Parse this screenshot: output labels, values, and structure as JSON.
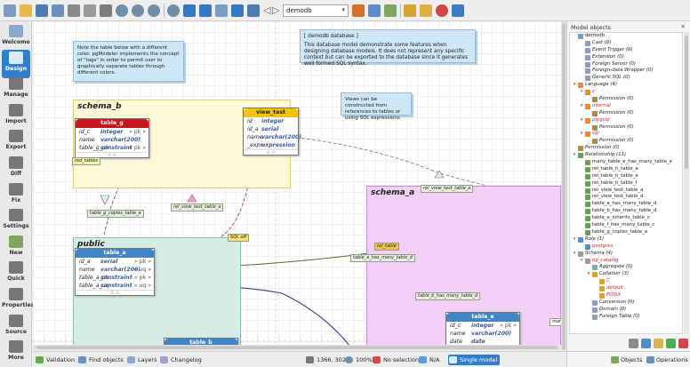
{
  "toolbar": {
    "database_combo": "demodb",
    "icons": [
      "new-model-icon",
      "open-icon",
      "save-icon",
      "save-as-icon",
      "print-icon",
      "print-preview-icon",
      "undo-icon",
      "zoom-in-icon",
      "zoom-out-icon",
      "zoom-normal-icon",
      "zoom-fit-icon",
      "grid-icon",
      "grid-align-icon",
      "overview-icon",
      "delete-icon",
      "arrange-icon",
      "back-icon",
      "forward-icon",
      "import-icon",
      "export-icon",
      "fix-icon",
      "plugins-icon",
      "bug-icon",
      "help-icon",
      "about-icon"
    ]
  },
  "sidebar": {
    "items": [
      {
        "label": "Welcome",
        "icon": "welcome-icon"
      },
      {
        "label": "Design",
        "icon": "design-icon",
        "active": true
      },
      {
        "label": "Manage",
        "icon": "manage-icon"
      },
      {
        "label": "Import",
        "icon": "import-icon"
      },
      {
        "label": "Export",
        "icon": "export-icon"
      },
      {
        "label": "Diff",
        "icon": "diff-icon"
      },
      {
        "label": "Fix",
        "icon": "fix-icon"
      },
      {
        "label": "Settings",
        "icon": "settings-icon"
      },
      {
        "label": "New",
        "icon": "new-icon"
      },
      {
        "label": "Quick",
        "icon": "quick-icon"
      },
      {
        "label": "Properties",
        "icon": "properties-icon"
      },
      {
        "label": "Source",
        "icon": "source-icon"
      },
      {
        "label": "More",
        "icon": "more-icon"
      }
    ]
  },
  "canvas": {
    "note1": "Note the table below with a different color. pgModeler implements the concept of \"tags\" in order to permit user to graphically separate tables through different colors.",
    "note2_title": "[ demodb database ]",
    "note2_body": "This database model demonstrate some features when designing database models. It does not represent any specific context but can be exported to the database since it generates well formed SQL syntax.",
    "note3": "Views can be constructed from references to tables or using SQL expressions.",
    "schema_b": "schema_b",
    "schema_a": "schema_a",
    "public": "public",
    "sql_off_tag": "SQL off",
    "table_g": {
      "title": "table_g",
      "rows": [
        {
          "name": "id_c",
          "type": "integer",
          "cons": "« pk »"
        },
        {
          "name": "name",
          "type": "varchar(200)",
          "cons": ""
        },
        {
          "name": "table_g_pk",
          "type": "constraint",
          "cons": "« pk »"
        }
      ],
      "tag": "red_tables"
    },
    "view_test": {
      "title": "view_test",
      "rows": [
        {
          "name": "id",
          "type": "integer"
        },
        {
          "name": "id_a",
          "type": "serial"
        },
        {
          "name": "name",
          "type": "varchar(200)"
        },
        {
          "name": "_expr",
          "type": "expression"
        }
      ]
    },
    "table_a": {
      "title": "table_a",
      "rows": [
        {
          "name": "id_a",
          "type": "serial",
          "cons": "« pk »"
        },
        {
          "name": "name",
          "type": "varchar(200)",
          "cons": "« uq »"
        },
        {
          "name": "table_a_pk",
          "type": "constraint",
          "cons": "« pk »"
        },
        {
          "name": "table_a_uq",
          "type": "constraint",
          "cons": "« uq »"
        }
      ]
    },
    "table_b_title": "table_b",
    "table_e": {
      "title": "table_e",
      "rows": [
        {
          "name": "id_c",
          "type": "integer",
          "cons": "« pk »"
        },
        {
          "name": "name",
          "type": "varchar(200)",
          "cons": ""
        },
        {
          "name": "date",
          "type": "date",
          "cons": ""
        }
      ]
    },
    "labels": {
      "rel_view_test_table_a_top": "rel_view_test_table_a",
      "rel_view_test_table_a": "rel_view_test_table_a",
      "table_g_copies_table_a": "table_g_copies_table_a",
      "table_a_has_many_table_d": "table_a_has_many_table_d",
      "table_b_has_many_table_d": "table_b_has_many_table_d",
      "rel_table": "rel_table",
      "many": "many"
    }
  },
  "status": {
    "validation": "Validation",
    "find_objects": "Find objects",
    "layers": "Layers",
    "changelog": "Changelog",
    "coords": "1366, 302",
    "zoom": "100%",
    "selection": "No selection",
    "na": "N/A",
    "single_model": "Single model"
  },
  "objects_panel": {
    "title": "Model objects",
    "tree": [
      {
        "depth": 0,
        "toggle": "",
        "label": "demodb",
        "icon": "database-icon",
        "color": "#222"
      },
      {
        "depth": 1,
        "toggle": "",
        "label": "Cast (0)",
        "icon": "cast-icon",
        "color": "#222",
        "italic": true
      },
      {
        "depth": 1,
        "toggle": "",
        "label": "Event Trigger (0)",
        "icon": "event-trigger-icon",
        "color": "#222",
        "italic": true
      },
      {
        "depth": 1,
        "toggle": "",
        "label": "Extension (0)",
        "icon": "extension-icon",
        "color": "#222",
        "italic": true
      },
      {
        "depth": 1,
        "toggle": "",
        "label": "Foreign Server (0)",
        "icon": "foreign-server-icon",
        "color": "#222",
        "italic": true
      },
      {
        "depth": 1,
        "toggle": "",
        "label": "Foreign-data Wrapper (0)",
        "icon": "fdw-icon",
        "color": "#222",
        "italic": true
      },
      {
        "depth": 1,
        "toggle": "",
        "label": "Generic SQL (0)",
        "icon": "generic-sql-icon",
        "color": "#222",
        "italic": true
      },
      {
        "depth": 0,
        "toggle": "▾",
        "label": "Language (4)",
        "icon": "language-icon",
        "color": "#222",
        "italic": true
      },
      {
        "depth": 1,
        "toggle": "▾",
        "label": "c",
        "icon": "language-icon",
        "color": "#d22",
        "italic": true
      },
      {
        "depth": 2,
        "toggle": "",
        "label": "Permission (0)",
        "icon": "permission-icon",
        "color": "#222",
        "italic": true
      },
      {
        "depth": 1,
        "toggle": "▾",
        "label": "internal",
        "icon": "language-icon",
        "color": "#d22",
        "italic": true
      },
      {
        "depth": 2,
        "toggle": "",
        "label": "Permission (0)",
        "icon": "permission-icon",
        "color": "#222",
        "italic": true
      },
      {
        "depth": 1,
        "toggle": "▾",
        "label": "plpgsql",
        "icon": "language-icon",
        "color": "#d22",
        "italic": true
      },
      {
        "depth": 2,
        "toggle": "",
        "label": "Permission (0)",
        "icon": "permission-icon",
        "color": "#222",
        "italic": true
      },
      {
        "depth": 1,
        "toggle": "▾",
        "label": "sql",
        "icon": "language-icon",
        "color": "#d22",
        "italic": true
      },
      {
        "depth": 2,
        "toggle": "",
        "label": "Permission (0)",
        "icon": "permission-icon",
        "color": "#222",
        "italic": true
      },
      {
        "depth": 0,
        "toggle": "",
        "label": "Permission (0)",
        "icon": "permission-icon",
        "color": "#222",
        "italic": true
      },
      {
        "depth": 0,
        "toggle": "▾",
        "label": "Relationship (11)",
        "icon": "relationship-icon",
        "color": "#222",
        "italic": true
      },
      {
        "depth": 1,
        "toggle": "",
        "label": "many_table_e_has_many_table_e",
        "icon": "relationship-icon",
        "color": "#222"
      },
      {
        "depth": 1,
        "toggle": "",
        "label": "rel_table_h_table_a",
        "icon": "relationship-icon",
        "color": "#222"
      },
      {
        "depth": 1,
        "toggle": "",
        "label": "rel_table_h_table_e",
        "icon": "relationship-icon",
        "color": "#222"
      },
      {
        "depth": 1,
        "toggle": "",
        "label": "rel_table_h_table_f",
        "icon": "relationship-icon",
        "color": "#222"
      },
      {
        "depth": 1,
        "toggle": "",
        "label": "rel_view_test_table_a",
        "icon": "relationship-icon",
        "color": "#222"
      },
      {
        "depth": 1,
        "toggle": "",
        "label": "rel_view_test_table_d",
        "icon": "relationship-icon",
        "color": "#222"
      },
      {
        "depth": 1,
        "toggle": "",
        "label": "table_a_has_many_table_d",
        "icon": "relationship-icon",
        "color": "#222"
      },
      {
        "depth": 1,
        "toggle": "",
        "label": "table_b_has_many_table_d",
        "icon": "relationship-icon",
        "color": "#222"
      },
      {
        "depth": 1,
        "toggle": "",
        "label": "table_e_inherits_table_c",
        "icon": "relationship-icon",
        "color": "#222"
      },
      {
        "depth": 1,
        "toggle": "",
        "label": "table_f_has_many_table_c",
        "icon": "relationship-icon",
        "color": "#222"
      },
      {
        "depth": 1,
        "toggle": "",
        "label": "table_g_copies_table_a",
        "icon": "relationship-icon",
        "color": "#222"
      },
      {
        "depth": 0,
        "toggle": "▾",
        "label": "Role (1)",
        "icon": "role-icon",
        "color": "#222",
        "italic": true
      },
      {
        "depth": 1,
        "toggle": "",
        "label": "postgres",
        "icon": "role-icon",
        "color": "#d22",
        "italic": true
      },
      {
        "depth": 0,
        "toggle": "▾",
        "label": "Schema (4)",
        "icon": "schema-icon",
        "color": "#222",
        "italic": true
      },
      {
        "depth": 1,
        "toggle": "▾",
        "label": "pg_catalog",
        "icon": "schema-icon",
        "color": "#d22",
        "italic": true
      },
      {
        "depth": 2,
        "toggle": "",
        "label": "Aggregate (0)",
        "icon": "aggregate-icon",
        "color": "#222",
        "italic": true
      },
      {
        "depth": 2,
        "toggle": "▾",
        "label": "Collation (3)",
        "icon": "collation-icon",
        "color": "#222",
        "italic": true
      },
      {
        "depth": 3,
        "toggle": "",
        "label": "C",
        "icon": "collation-icon",
        "color": "#d22",
        "italic": true
      },
      {
        "depth": 3,
        "toggle": "",
        "label": "default",
        "icon": "collation-icon",
        "color": "#d22",
        "italic": true
      },
      {
        "depth": 3,
        "toggle": "",
        "label": "POSIX",
        "icon": "collation-icon",
        "color": "#d22",
        "italic": true
      },
      {
        "depth": 2,
        "toggle": "",
        "label": "Conversion (0)",
        "icon": "conversion-icon",
        "color": "#222",
        "italic": true
      },
      {
        "depth": 2,
        "toggle": "",
        "label": "Domain (0)",
        "icon": "domain-icon",
        "color": "#222",
        "italic": true
      },
      {
        "depth": 2,
        "toggle": "",
        "label": "Foreign Table (0)",
        "icon": "foreign-table-icon",
        "color": "#222",
        "italic": true
      }
    ],
    "tabs": {
      "objects": "Objects",
      "operations": "Operations"
    }
  },
  "colors": {
    "accent": "#2f7fd1",
    "table_g_header": "#c8171e",
    "view_header": "#f2c40f",
    "table_header": "#3f86c6",
    "schema_b_bg": "#fff8d6",
    "schema_a_bg": "#f1cff7",
    "public_bg": "#d5ece6"
  }
}
